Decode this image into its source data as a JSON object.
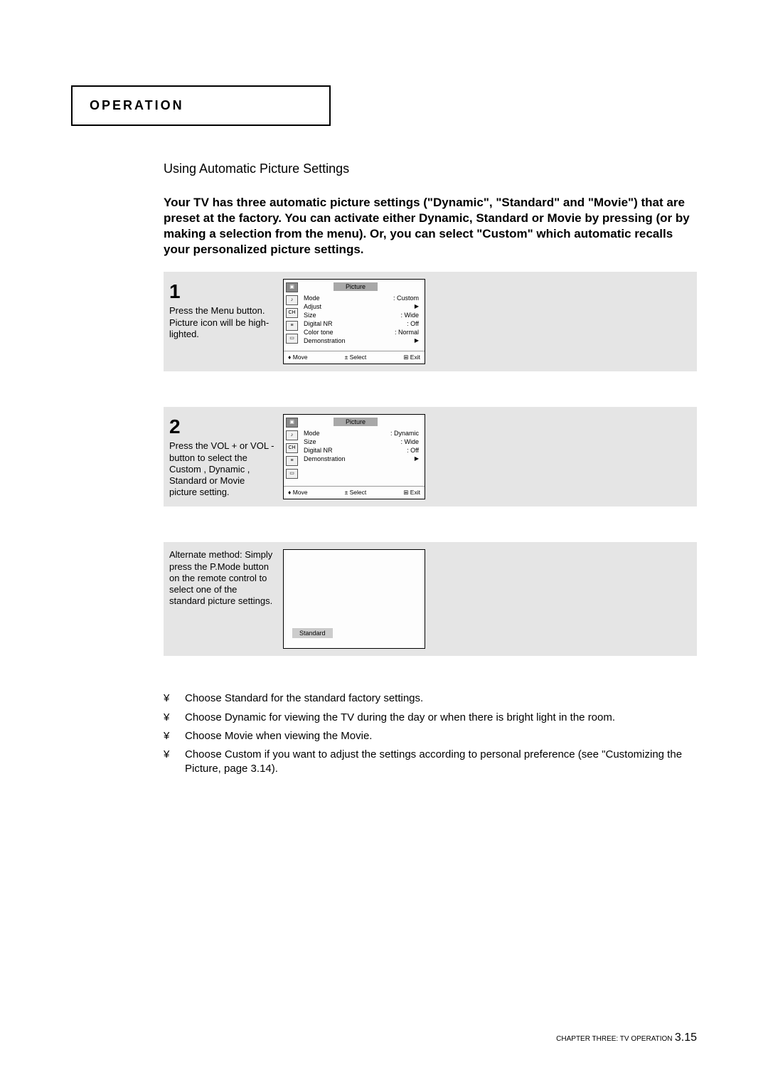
{
  "header": {
    "operation_label": "OPERATION"
  },
  "section_heading": "Using Automatic Picture Settings",
  "intro": "Your TV has three automatic picture settings (\"Dynamic\", \"Standard\" and \"Movie\") that are preset at the factory.  You can activate either Dynamic, Standard or Movie by pressing (or by making a selection from the menu). Or, you can select \"Custom\" which automatic recalls your personalized picture settings.",
  "step1": {
    "number": "1",
    "text_pre": "Press the ",
    "text_em": "Menu",
    "text_post": " button. Picture icon will be high-lighted.",
    "screen": {
      "title": "Picture",
      "rows": [
        {
          "label": "Mode",
          "value": ": Custom"
        },
        {
          "label": "Adjust",
          "value": "▶"
        },
        {
          "label": "Size",
          "value": ": Wide"
        },
        {
          "label": "Digital NR",
          "value": ": Off"
        },
        {
          "label": "Color tone",
          "value": ": Normal"
        },
        {
          "label": "Demonstration",
          "value": "▶"
        }
      ],
      "footer": {
        "move": "♦ Move",
        "select": "± Select",
        "exit": "⊞ Exit"
      }
    }
  },
  "step2": {
    "number": "2",
    "text": "Press the VOL + or VOL - button to select the Custom , Dynamic , Standard  or  Movie picture setting.",
    "screen": {
      "title": "Picture",
      "rows": [
        {
          "label": "Mode",
          "value": ": Dynamic"
        },
        {
          "label": "Size",
          "value": ": Wide"
        },
        {
          "label": "Digital NR",
          "value": ": Off"
        },
        {
          "label": "Demonstration",
          "value": "▶"
        }
      ],
      "footer": {
        "move": "♦ Move",
        "select": "± Select",
        "exit": "⊞ Exit"
      }
    }
  },
  "alternate": {
    "text_pre": "Alternate method: Simply press the ",
    "text_em": "P.Mode",
    "text_post": " button on the remote control to select one of the standard picture settings.",
    "pill": "Standard"
  },
  "bullets": [
    "Choose Standard for the standard factory settings.",
    "Choose Dynamic for viewing the TV during the day or when there is bright light in the room.",
    "Choose Movie when viewing the Movie.",
    "Choose Custom if you want to adjust the settings according to personal preference (see \"Customizing the Picture, page 3.14)."
  ],
  "bullet_mark": "¥",
  "footer": {
    "chapter": "CHAPTER THREE: TV OPERATION",
    "page": "3.15"
  }
}
